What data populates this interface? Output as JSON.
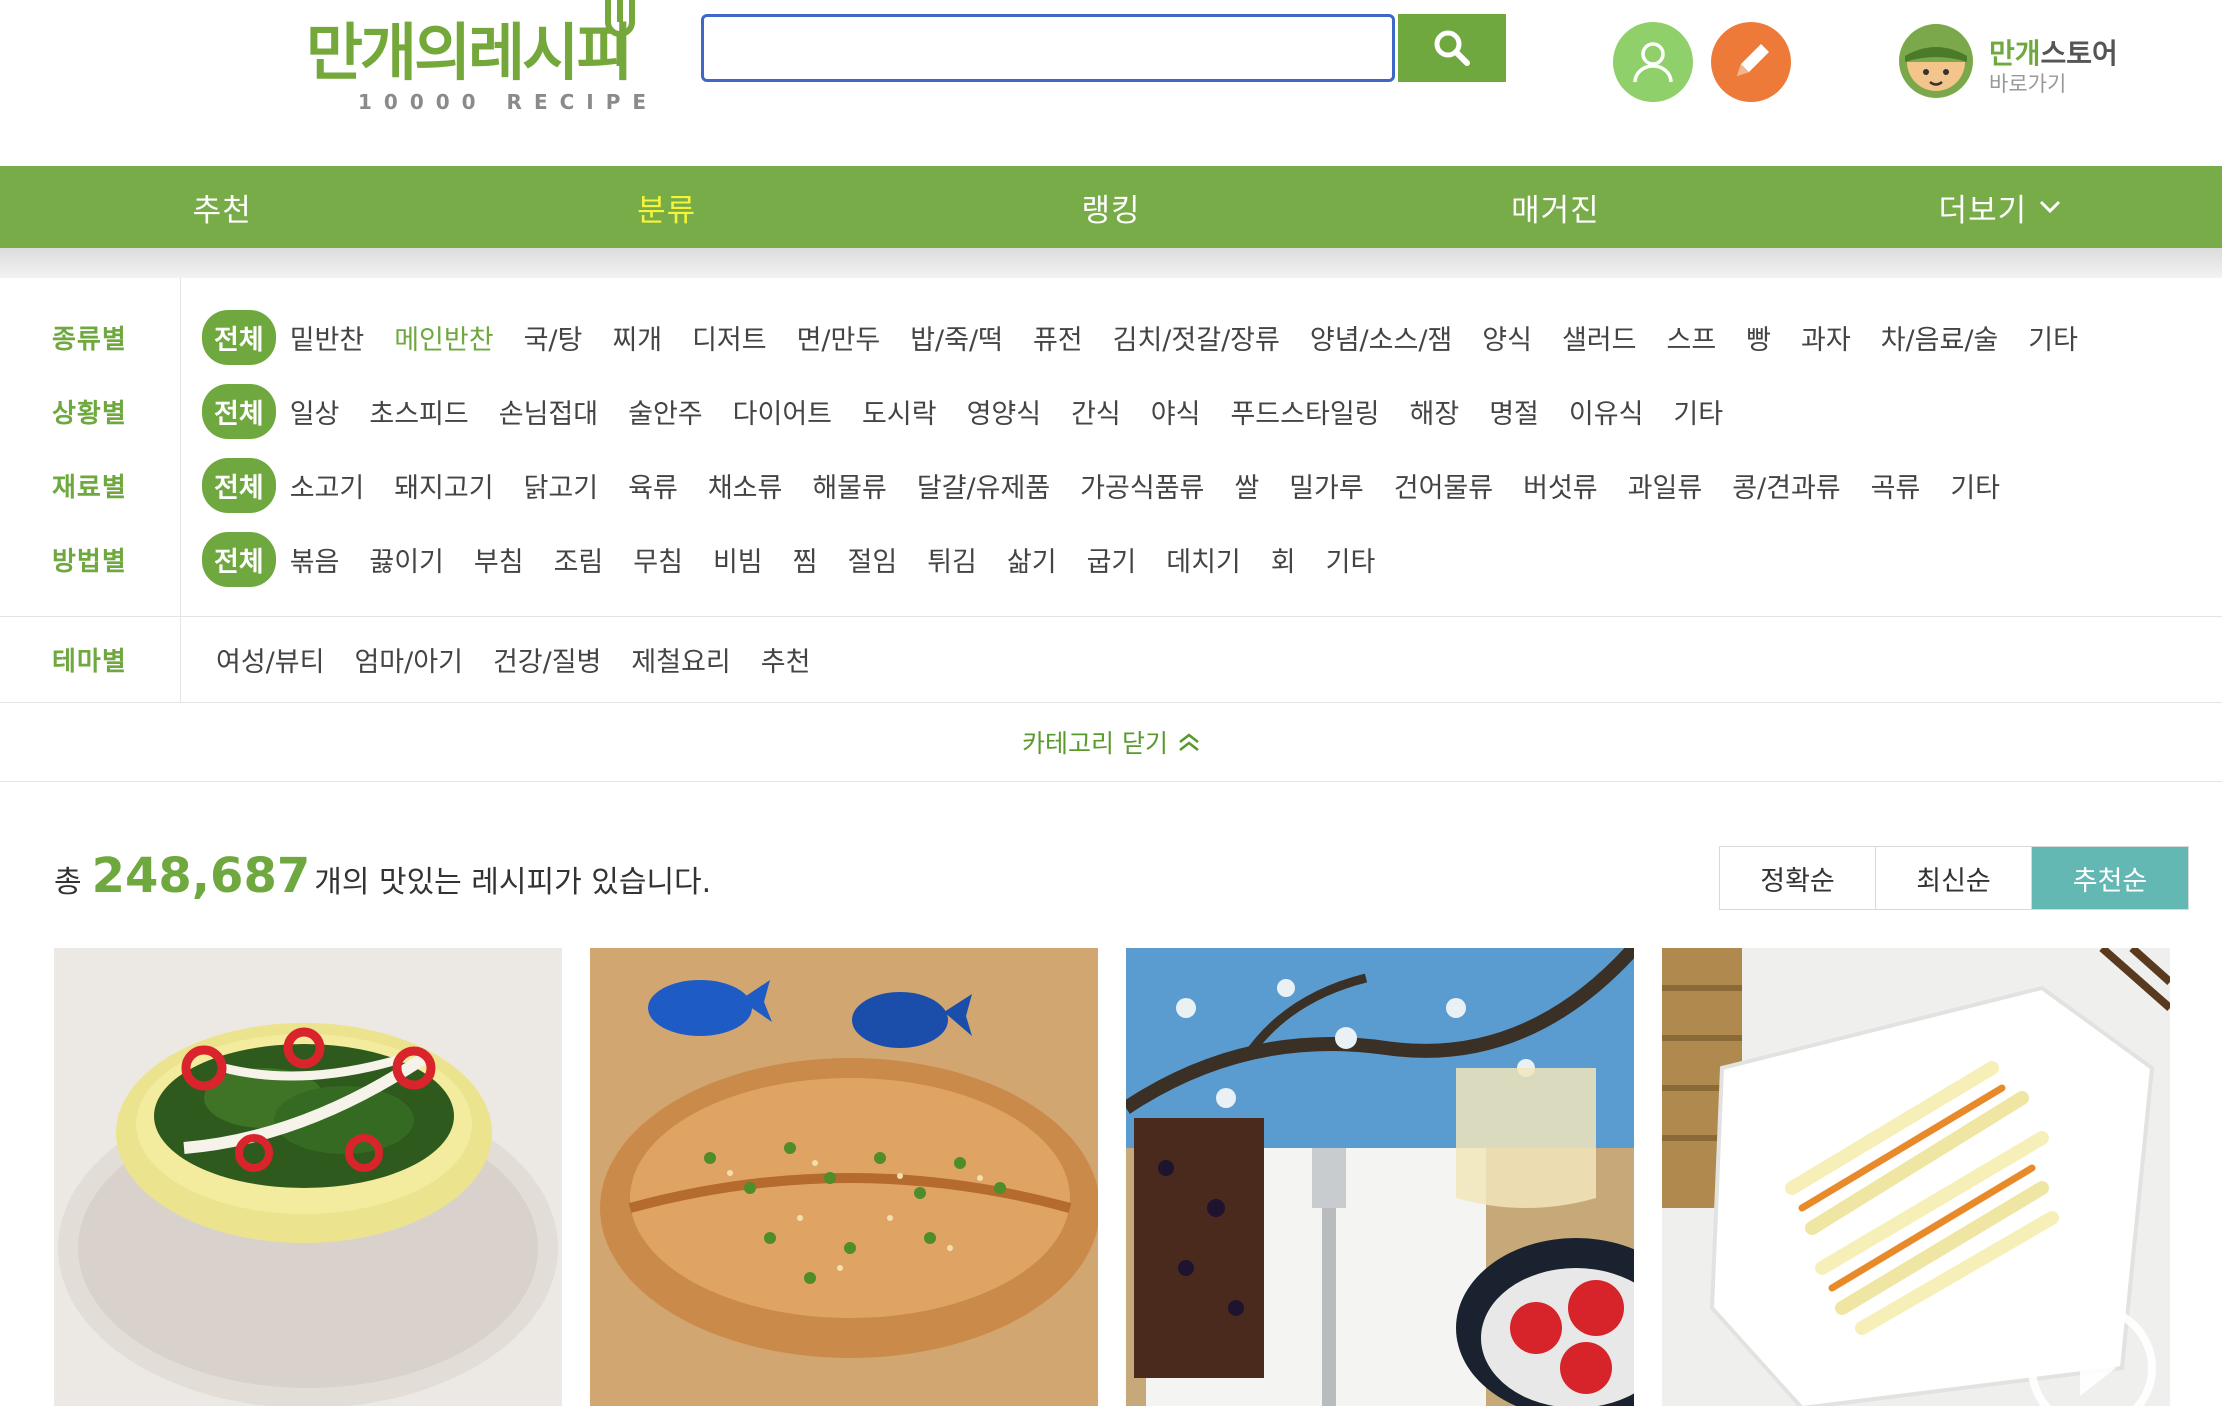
{
  "header": {
    "logo_main": "만개의레시피",
    "logo_sub": "10000 RECIPE",
    "search": {
      "value": "",
      "placeholder": ""
    },
    "store": {
      "name_accent": "만개",
      "name_rest": "스토어",
      "sub": "바로가기"
    }
  },
  "icons": {
    "search": "search-icon",
    "user": "user-icon",
    "write": "pencil-icon",
    "store": "store-mascot-icon",
    "more": "chevron-down-icon",
    "collapse": "chevron-up-icon"
  },
  "colors": {
    "brand_green": "#78ac48",
    "accent_green": "#6ea83f",
    "active_nav": "#f4f43a",
    "user_button": "#8fd06a",
    "write_button": "#ed7a38",
    "active_sort": "#63b8b4",
    "search_border": "#3d68c8"
  },
  "nav": {
    "items": [
      {
        "label": "추천",
        "active": false
      },
      {
        "label": "분류",
        "active": true
      },
      {
        "label": "랭킹",
        "active": false
      },
      {
        "label": "매거진",
        "active": false
      },
      {
        "label": "더보기",
        "active": false
      }
    ]
  },
  "categories": {
    "rows": [
      {
        "label": "종류별",
        "items": [
          "전체",
          "밑반찬",
          "메인반찬",
          "국/탕",
          "찌개",
          "디저트",
          "면/만두",
          "밥/죽/떡",
          "퓨전",
          "김치/젓갈/장류",
          "양념/소스/잼",
          "양식",
          "샐러드",
          "스프",
          "빵",
          "과자",
          "차/음료/술",
          "기타"
        ],
        "active": "메인반찬"
      },
      {
        "label": "상황별",
        "items": [
          "전체",
          "일상",
          "초스피드",
          "손님접대",
          "술안주",
          "다이어트",
          "도시락",
          "영양식",
          "간식",
          "야식",
          "푸드스타일링",
          "해장",
          "명절",
          "이유식",
          "기타"
        ],
        "active": ""
      },
      {
        "label": "재료별",
        "items": [
          "전체",
          "소고기",
          "돼지고기",
          "닭고기",
          "육류",
          "채소류",
          "해물류",
          "달걀/유제품",
          "가공식품류",
          "쌀",
          "밀가루",
          "건어물류",
          "버섯류",
          "과일류",
          "콩/견과류",
          "곡류",
          "기타"
        ],
        "active": ""
      },
      {
        "label": "방법별",
        "items": [
          "전체",
          "볶음",
          "끓이기",
          "부침",
          "조림",
          "무침",
          "비빔",
          "찜",
          "절임",
          "튀김",
          "삶기",
          "굽기",
          "데치기",
          "회",
          "기타"
        ],
        "active": ""
      }
    ],
    "theme": {
      "label": "테마별",
      "items": [
        "여성/뷰티",
        "엄마/아기",
        "건강/질병",
        "제철요리",
        "추천"
      ]
    },
    "close_label": "카테고리 닫기"
  },
  "results": {
    "prefix": "총",
    "count": "248,687",
    "suffix": "개의 맛있는 레시피가 있습니다.",
    "sort_options": [
      {
        "label": "정확순",
        "active": false
      },
      {
        "label": "최신순",
        "active": false
      },
      {
        "label": "추천순",
        "active": true
      }
    ]
  },
  "recipes": [
    {
      "image": "seasoned-greens-with-chili-in-yellow-bowl"
    },
    {
      "image": "grilled-dried-fish-with-sesame-and-scallion"
    },
    {
      "image": "chocolate-loaf-with-fork-and-strawberries"
    },
    {
      "image": "stir-fried-potato-strips-on-white-plate"
    }
  ]
}
